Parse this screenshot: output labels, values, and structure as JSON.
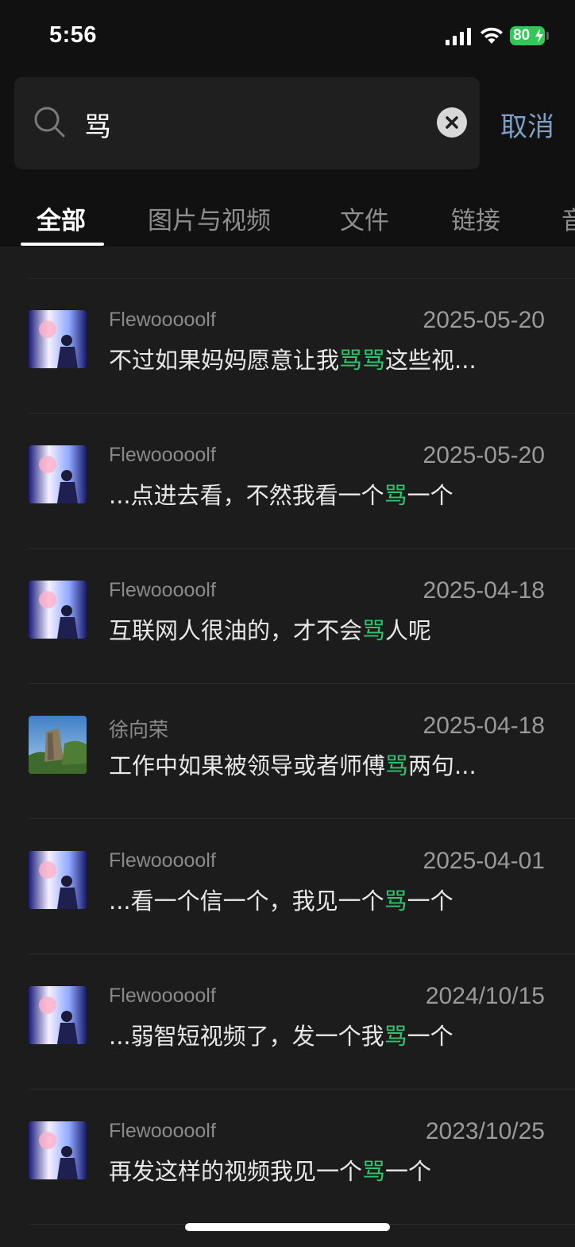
{
  "status": {
    "time": "5:56",
    "battery": "80"
  },
  "search": {
    "query": "骂",
    "cancel_label": "取消"
  },
  "tabs": [
    {
      "label": "全部",
      "active": true
    },
    {
      "label": "图片与视频",
      "active": false
    },
    {
      "label": "文件",
      "active": false
    },
    {
      "label": "链接",
      "active": false
    },
    {
      "label": "音",
      "active": false
    }
  ],
  "results": [
    {
      "sender": "Flewooooolf",
      "date": "2025-05-20",
      "avatar": "anime-avatar",
      "pre": "不过如果妈妈愿意让我",
      "match": "骂骂",
      "post": "这些视..."
    },
    {
      "sender": "Flewooooolf",
      "date": "2025-05-20",
      "avatar": "anime-avatar",
      "pre": "...点进去看，不然我看一个",
      "match": "骂",
      "post": "一个"
    },
    {
      "sender": "Flewooooolf",
      "date": "2025-04-18",
      "avatar": "anime-avatar",
      "pre": "互联网人很油的，才不会",
      "match": "骂",
      "post": "人呢"
    },
    {
      "sender": "徐向荣",
      "date": "2025-04-18",
      "avatar": "landscape-avatar",
      "pre": "工作中如果被领导或者师傅",
      "match": "骂",
      "post": "两句..."
    },
    {
      "sender": "Flewooooolf",
      "date": "2025-04-01",
      "avatar": "anime-avatar",
      "pre": "...看一个信一个，我见一个",
      "match": "骂",
      "post": "一个"
    },
    {
      "sender": "Flewooooolf",
      "date": "2024/10/15",
      "avatar": "anime-avatar",
      "pre": "...弱智短视频了，发一个我",
      "match": "骂",
      "post": "一个"
    },
    {
      "sender": "Flewooooolf",
      "date": "2023/10/25",
      "avatar": "anime-avatar",
      "pre": "再发这样的视频我见一个",
      "match": "骂",
      "post": "一个"
    }
  ],
  "colors": {
    "highlight": "#2fc46e",
    "cancel": "#7f9fc6",
    "battery": "#33c759"
  }
}
